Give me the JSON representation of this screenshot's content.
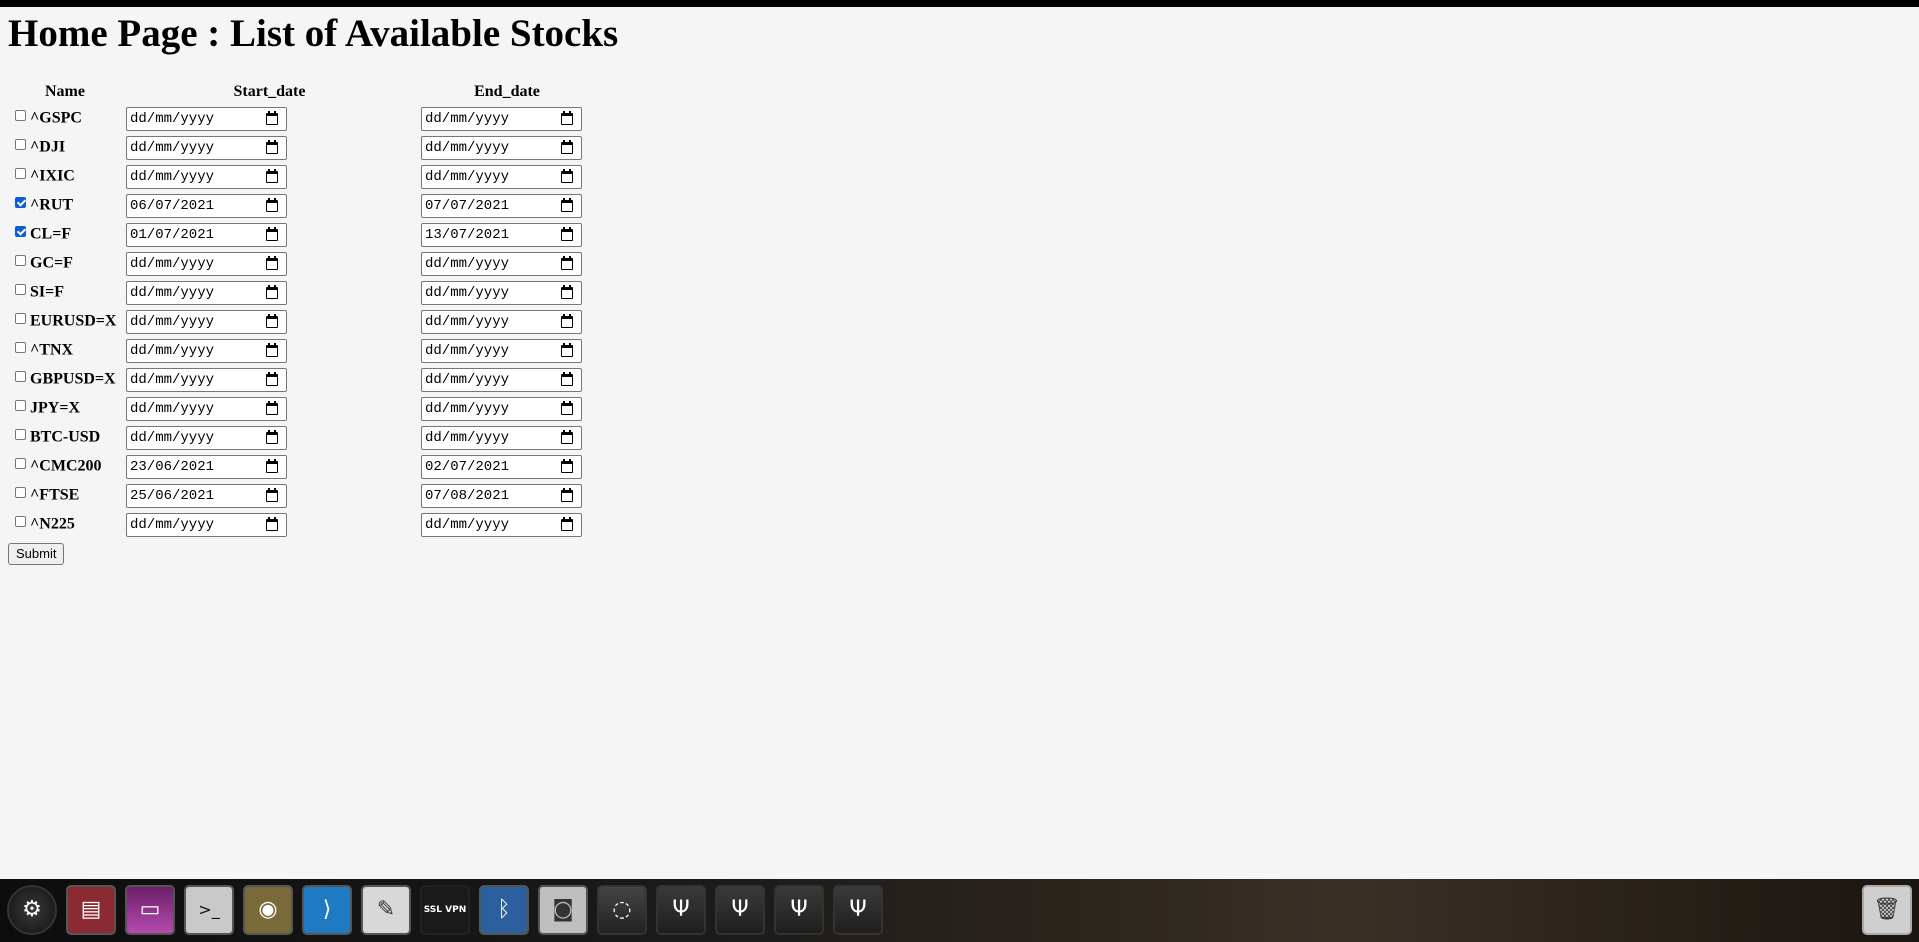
{
  "page": {
    "title": "Home Page : List of Available Stocks"
  },
  "table": {
    "headers": {
      "name": "Name",
      "start": "Start_date",
      "end": "End_date"
    },
    "rows": [
      {
        "name": "^GSPC",
        "checked": false,
        "start": "dd/mm/yyyy",
        "end": "dd/mm/yyyy"
      },
      {
        "name": "^DJI",
        "checked": false,
        "start": "dd/mm/yyyy",
        "end": "dd/mm/yyyy"
      },
      {
        "name": "^IXIC",
        "checked": false,
        "start": "dd/mm/yyyy",
        "end": "dd/mm/yyyy"
      },
      {
        "name": "^RUT",
        "checked": true,
        "start": "06/07/2021",
        "end": "07/07/2021"
      },
      {
        "name": "CL=F",
        "checked": true,
        "start": "01/07/2021",
        "end": "13/07/2021"
      },
      {
        "name": "GC=F",
        "checked": false,
        "start": "dd/mm/yyyy",
        "end": "dd/mm/yyyy"
      },
      {
        "name": "SI=F",
        "checked": false,
        "start": "dd/mm/yyyy",
        "end": "dd/mm/yyyy"
      },
      {
        "name": "EURUSD=X",
        "checked": false,
        "start": "dd/mm/yyyy",
        "end": "dd/mm/yyyy"
      },
      {
        "name": "^TNX",
        "checked": false,
        "start": "dd/mm/yyyy",
        "end": "dd/mm/yyyy"
      },
      {
        "name": "GBPUSD=X",
        "checked": false,
        "start": "dd/mm/yyyy",
        "end": "dd/mm/yyyy"
      },
      {
        "name": "JPY=X",
        "checked": false,
        "start": "dd/mm/yyyy",
        "end": "dd/mm/yyyy"
      },
      {
        "name": "BTC-USD",
        "checked": false,
        "start": "dd/mm/yyyy",
        "end": "dd/mm/yyyy"
      },
      {
        "name": "^CMC200",
        "checked": false,
        "start": "23/06/2021",
        "end": "02/07/2021"
      },
      {
        "name": "^FTSE",
        "checked": false,
        "start": "25/06/2021",
        "end": "07/08/2021"
      },
      {
        "name": "^N225",
        "checked": false,
        "start": "dd/mm/yyyy",
        "end": "dd/mm/yyyy"
      }
    ]
  },
  "form": {
    "submit_label": "Submit"
  },
  "dock": {
    "items": [
      {
        "icon": "ubuntu-logo-icon",
        "glyph": "⚙"
      },
      {
        "icon": "file-cabinet-icon",
        "glyph": "▤"
      },
      {
        "icon": "window-app-icon",
        "glyph": "▭"
      },
      {
        "icon": "terminal-icon",
        "glyph": ">_"
      },
      {
        "icon": "chrome-icon",
        "glyph": "◉"
      },
      {
        "icon": "vscode-icon",
        "glyph": "⟩"
      },
      {
        "icon": "text-editor-icon",
        "glyph": "✎"
      },
      {
        "icon": "ssl-vpn-icon",
        "glyph": "SSL VPN"
      },
      {
        "icon": "bluetooth-icon",
        "glyph": "ᛒ"
      },
      {
        "icon": "camera-icon",
        "glyph": "◙"
      },
      {
        "icon": "hard-drive-icon",
        "glyph": "◌"
      },
      {
        "icon": "usb-drive-icon",
        "glyph": "Ψ"
      },
      {
        "icon": "usb-drive-icon",
        "glyph": "Ψ"
      },
      {
        "icon": "usb-drive-icon",
        "glyph": "Ψ"
      },
      {
        "icon": "usb-drive-icon",
        "glyph": "Ψ"
      },
      {
        "icon": "trash-icon",
        "glyph": "🗑"
      }
    ],
    "accent": "#0b5ed7"
  }
}
